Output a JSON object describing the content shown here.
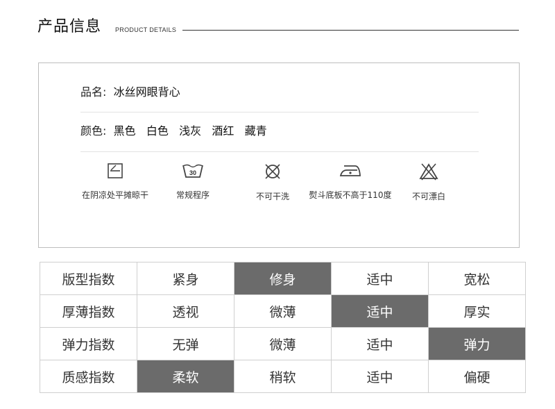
{
  "header": {
    "title": "产品信息",
    "subtitle": "PRODUCT DETAILS"
  },
  "product": {
    "name_label": "品名:",
    "name_value": "冰丝网眼背心",
    "color_label": "颜色:",
    "colors": [
      "黑色",
      "白色",
      "浅灰",
      "酒红",
      "藏青"
    ]
  },
  "care": [
    {
      "icon": "line-dry-icon",
      "label": "在阴凉处平摊晾干"
    },
    {
      "icon": "wash-30-icon",
      "label": "常规程序",
      "wash_temp": "30"
    },
    {
      "icon": "no-dry-clean-icon",
      "label": "不可干洗"
    },
    {
      "icon": "iron-icon",
      "label": "熨斗底板不高于110度"
    },
    {
      "icon": "no-bleach-icon",
      "label": "不可漂白"
    }
  ],
  "ratings": [
    {
      "label": "版型指数",
      "options": [
        "紧身",
        "修身",
        "适中",
        "宽松"
      ],
      "selected": 1
    },
    {
      "label": "厚薄指数",
      "options": [
        "透视",
        "微薄",
        "适中",
        "厚实"
      ],
      "selected": 2
    },
    {
      "label": "弹力指数",
      "options": [
        "无弹",
        "微薄",
        "适中",
        "弹力"
      ],
      "selected": 3
    },
    {
      "label": "质感指数",
      "options": [
        "柔软",
        "稍软",
        "适中",
        "偏硬"
      ],
      "selected": 0
    }
  ],
  "colors": {
    "selected_bg": "#6b6b6b",
    "border": "#cfcfcf"
  }
}
